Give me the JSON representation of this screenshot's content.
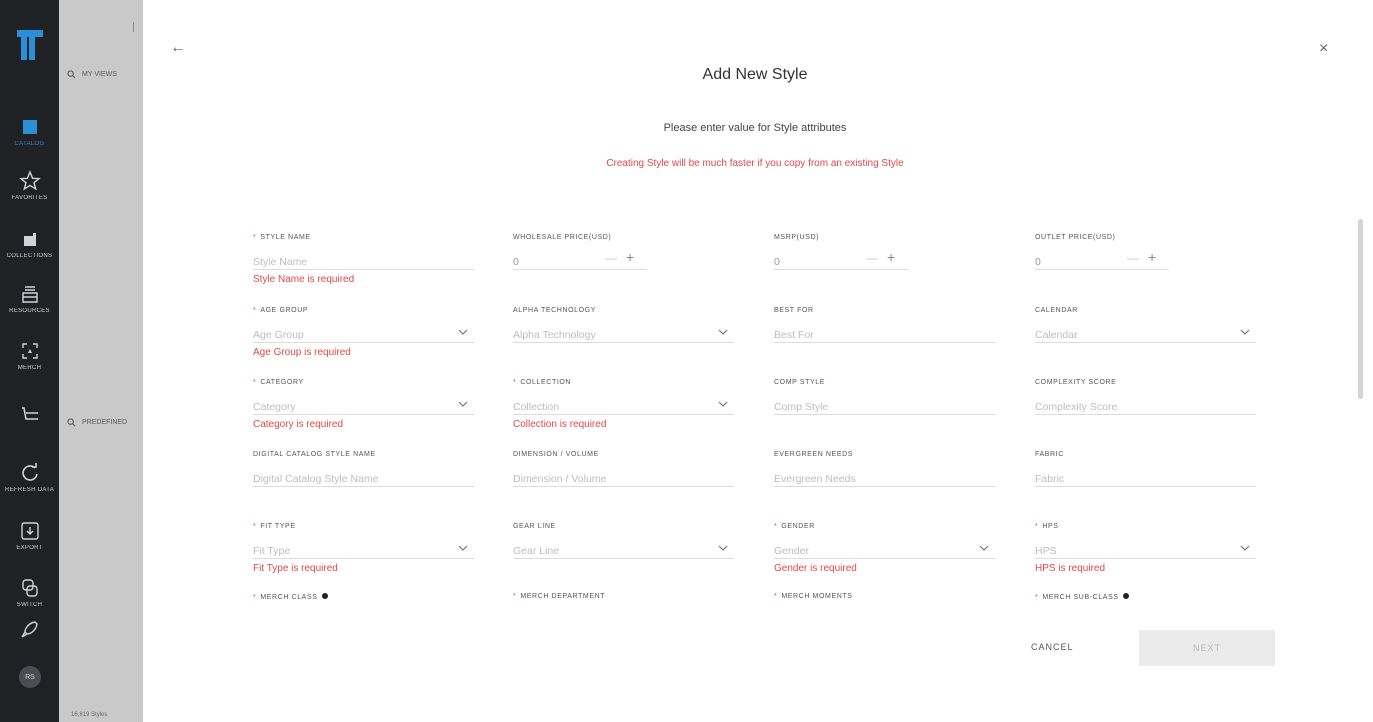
{
  "rail": {
    "items": [
      {
        "label": "CATALOG",
        "icon": "book-icon",
        "active": true
      },
      {
        "label": "FAVORITES",
        "icon": "star-icon"
      },
      {
        "label": "COLLECTIONS",
        "icon": "folder-icon"
      },
      {
        "label": "RESOURCES",
        "icon": "stack-icon"
      },
      {
        "label": "MERCH",
        "icon": "merch-icon"
      },
      {
        "label": "",
        "icon": "tray-icon"
      },
      {
        "label": "REFRESH DATA",
        "icon": "refresh-icon"
      },
      {
        "label": "EXPORT",
        "icon": "export-icon"
      },
      {
        "label": "SWITCH",
        "icon": "switch-icon"
      },
      {
        "label": "",
        "icon": "rocket-icon"
      }
    ],
    "avatar": "RS"
  },
  "background": {
    "my_views": "MY VIEWS",
    "predefined": "PREDEFINED",
    "bottom_text": "16,819 Styles"
  },
  "modal": {
    "title": "Add New Style",
    "subtitle": "Please enter value for Style attributes",
    "hint": "Creating Style will be much faster if you copy from an existing Style",
    "cancel_label": "CANCEL",
    "next_label": "NEXT",
    "fields": {
      "style_name": {
        "label": "STYLE NAME",
        "placeholder": "Style Name",
        "error": "Style Name is required"
      },
      "wholesale_price": {
        "label": "WHOLESALE PRICE(USD)",
        "value": "0"
      },
      "msrp": {
        "label": "MSRP(USD)",
        "value": "0"
      },
      "outlet_price": {
        "label": "OUTLET PRICE(USD)",
        "value": "0"
      },
      "age_group": {
        "label": "AGE GROUP",
        "placeholder": "Age Group",
        "error": "Age Group is required"
      },
      "alpha_technology": {
        "label": "ALPHA TECHNOLOGY",
        "placeholder": "Alpha Technology"
      },
      "best_for": {
        "label": "BEST FOR",
        "placeholder": "Best For"
      },
      "calendar": {
        "label": "CALENDAR",
        "placeholder": "Calendar"
      },
      "category": {
        "label": "CATEGORY",
        "placeholder": "Category",
        "error": "Category is required"
      },
      "collection": {
        "label": "COLLECTION",
        "placeholder": "Collection",
        "error": "Collection is required"
      },
      "comp_style": {
        "label": "COMP STYLE",
        "placeholder": "Comp Style"
      },
      "complexity_score": {
        "label": "COMPLEXITY SCORE",
        "placeholder": "Complexity Score"
      },
      "digital_catalog_style_name": {
        "label": "DIGITAL CATALOG STYLE NAME",
        "placeholder": "Digital Catalog Style Name"
      },
      "dimension_volume": {
        "label": "DIMENSION / VOLUME",
        "placeholder": "Dimension / Volume"
      },
      "evergreen_needs": {
        "label": "EVERGREEN NEEDS",
        "placeholder": "Evergreen Needs"
      },
      "fabric": {
        "label": "FABRIC",
        "placeholder": "Fabric"
      },
      "fit_type": {
        "label": "FIT TYPE",
        "placeholder": "Fit Type",
        "error": "Fit Type is required"
      },
      "gear_line": {
        "label": "GEAR LINE",
        "placeholder": "Gear Line"
      },
      "gender": {
        "label": "GENDER",
        "placeholder": "Gender",
        "error": "Gender is required"
      },
      "hps": {
        "label": "HPS",
        "placeholder": "HPS",
        "error": "HPS is required"
      },
      "merch_class": {
        "label": "MERCH CLASS"
      },
      "merch_department": {
        "label": "MERCH DEPARTMENT"
      },
      "merch_moments": {
        "label": "MERCH MOMENTS"
      },
      "merch_sub_class": {
        "label": "MERCH SUB-CLASS"
      }
    }
  },
  "colors": {
    "rail_bg": "#1f2124",
    "accent": "#2a8fd6",
    "error": "#e04949",
    "overlay": "#c9c9c9"
  }
}
